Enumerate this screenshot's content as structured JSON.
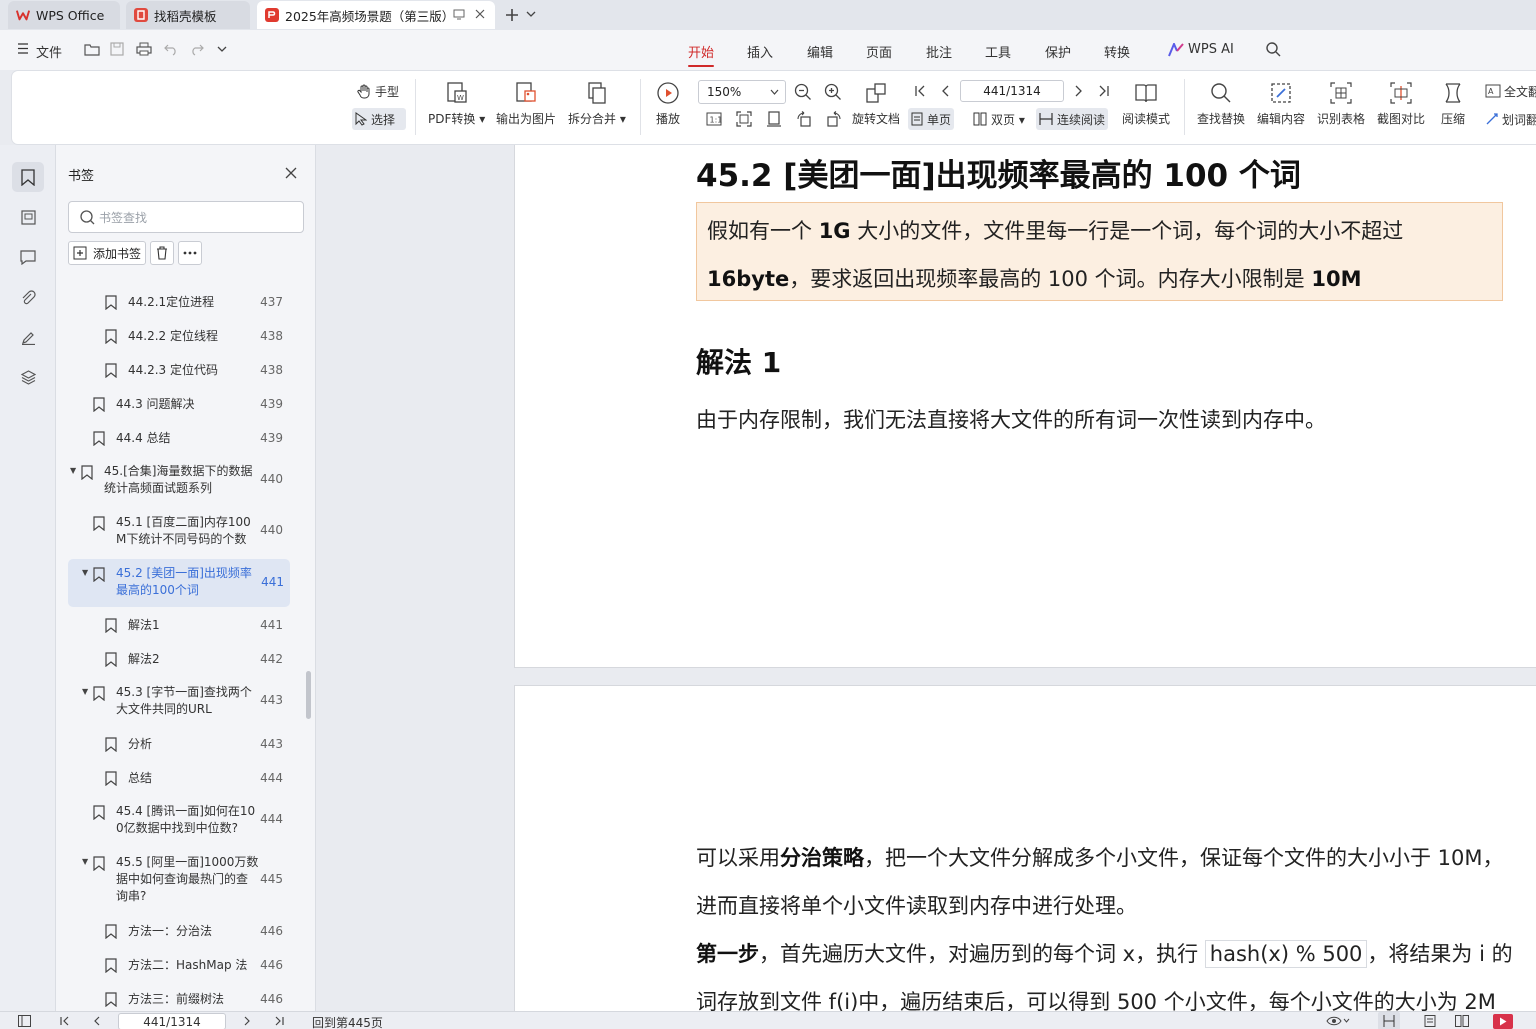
{
  "tabs": [
    {
      "label": "WPS Office"
    },
    {
      "label": "找稻壳模板"
    },
    {
      "label": "2025年高频场景题（第三版）"
    }
  ],
  "menu": {
    "file": "文件",
    "items": [
      "开始",
      "插入",
      "编辑",
      "页面",
      "批注",
      "工具",
      "保护",
      "转换"
    ],
    "wps_ai": "WPS AI"
  },
  "toolbar": {
    "hand": "手型",
    "select": "选择",
    "pdf_convert": "PDF转换",
    "export_image": "输出为图片",
    "split_merge": "拆分合并",
    "play": "播放",
    "zoom": "150%",
    "rotate": "旋转文档",
    "page_field": "441/1314",
    "single": "单页",
    "double": "双页",
    "continuous": "连续阅读",
    "read_mode": "阅读模式",
    "find_replace": "查找替换",
    "edit_content": "编辑内容",
    "recognize_table": "识别表格",
    "screenshot_compare": "截图对比",
    "compress": "压缩",
    "full_text": "全文翻",
    "word_translate": "划词翻"
  },
  "bookmarks": {
    "title": "书签",
    "search_placeholder": "书签查找",
    "add_label": "添加书签",
    "items": [
      {
        "label": "44.2.1定位进程",
        "page": "437"
      },
      {
        "label": "44.2.2 定位线程",
        "page": "438"
      },
      {
        "label": "44.2.3 定位代码",
        "page": "438"
      },
      {
        "label": "44.3 问题解决",
        "page": "439"
      },
      {
        "label": "44.4 总结",
        "page": "439"
      },
      {
        "label": "45.[合集]海量数据下的数据统计高频面试题系列",
        "line1": "45.[合集]海量数据下的数据",
        "line2": "统计高频面试题系列",
        "page": "440"
      },
      {
        "label": "45.1 [百度二面]内存100M下统计不同号码的个数",
        "line1": "45.1 [百度二面]内存100",
        "line2": "M下统计不同号码的个数",
        "page": "440"
      },
      {
        "label": "45.2 [美团一面]出现频率最高的100个词",
        "line1": "45.2 [美团一面]出现频率",
        "line2": "最高的100个词",
        "page": "441"
      },
      {
        "label": "解法1",
        "page": "441"
      },
      {
        "label": "解法2",
        "page": "442"
      },
      {
        "label": "45.3 [字节一面]查找两个大文件共同的URL",
        "line1": "45.3 [字节一面]查找两个",
        "line2": "大文件共同的URL",
        "page": "443"
      },
      {
        "label": "分析",
        "page": "443"
      },
      {
        "label": "总结",
        "page": "444"
      },
      {
        "label": "45.4 [腾讯一面]如何在100亿数据中找到中位数?",
        "line1": "45.4 [腾讯一面]如何在10",
        "line2": "0亿数据中找到中位数?",
        "page": "444"
      },
      {
        "label": "45.5 [阿里一面]1000万数据中如何查询最热门的查询串?",
        "line1": "45.5 [阿里一面]1000万数",
        "line2": "据中如何查询最热门的查",
        "line3": "询串?",
        "page": "445"
      },
      {
        "label": "方法一：分治法",
        "page": "446"
      },
      {
        "label": "方法二：HashMap 法",
        "page": "446"
      },
      {
        "label": "方法三：前缀树法",
        "page": "446"
      }
    ]
  },
  "document": {
    "heading": "45.2 [美团一面]出现频率最高的 100 个词",
    "callout": {
      "l1_a": "假如有一个 ",
      "l1_b": "1G",
      "l1_c": " 大小的文件，文件里每一行是一个词，每个词的大小不超过",
      "l2_a": "16byte",
      "l2_b": "，要求返回出现频率最高的 100 个词。内存大小限制是 ",
      "l2_c": "10M"
    },
    "subheading": "解法 1",
    "para1": "由于内存限制，我们无法直接将大文件的所有词一次性读到内存中。",
    "p2_l1_a": "可以采用",
    "p2_l1_b": "分治策略",
    "p2_l1_c": "，把一个大文件分解成多个小文件，保证每个文件的大小小于 10M，",
    "p2_l2": "进而直接将单个小文件读取到内存中进行处理。",
    "p3_l1_a": "第一步",
    "p3_l1_b": "，首先遍历大文件，对遍历到的每个词 x，执行 ",
    "p3_code": "hash(x) % 500",
    "p3_l1_c": "，将结果为 i 的",
    "p3_l2": "词存放到文件 f(i)中，遍历结束后，可以得到 500 个小文件，每个小文件的大小为 2M"
  },
  "status": {
    "page_field": "441/1314",
    "back_text": "回到第445页"
  }
}
